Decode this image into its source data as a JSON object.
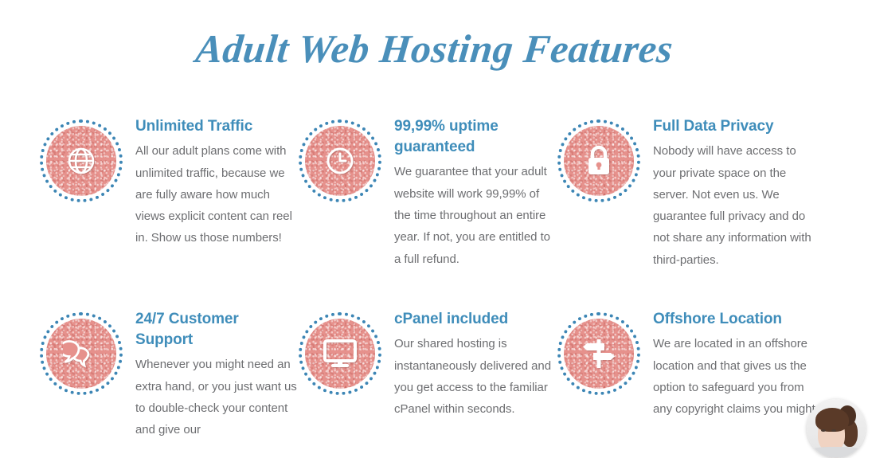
{
  "page": {
    "title": "Adult Web Hosting Features",
    "title_color": "#4a8fba",
    "body_text_color": "#6d6e71",
    "accent_blue": "#3f8dba",
    "badge_salmon": "#e6918c",
    "background": "#ffffff"
  },
  "features": [
    {
      "icon": "globe-icon",
      "title": "Unlimited Traffic",
      "description": "All our adult plans come with unlimited traffic, because we are fully aware how much views explicit content can reel in. Show us those numbers!"
    },
    {
      "icon": "clock-icon",
      "title": "99,99% uptime guaranteed",
      "description": "We guarantee that your adult website will work 99,99% of the time throughout an entire year. If not, you are entitled to a full refund."
    },
    {
      "icon": "padlock-icon",
      "title": "Full Data Privacy",
      "description": "Nobody will have access to your private space on the server. Not even us. We guarantee full privacy and do not share any information with third-parties."
    },
    {
      "icon": "speech-bubbles-icon",
      "title": "24/7 Customer Support",
      "description": "Whenever you might need an extra hand, or you just want us to double-check your content and give our"
    },
    {
      "icon": "monitor-icon",
      "title": "cPanel included",
      "description": "Our shared hosting is instantaneously delivered and you get access to the familiar cPanel within seconds."
    },
    {
      "icon": "signpost-icon",
      "title": "Offshore Location",
      "description": "We are located in an offshore location and that gives us the option to safeguard you from any copyright claims you might"
    }
  ],
  "chat_widget": {
    "icon": "chat-agent-avatar"
  }
}
